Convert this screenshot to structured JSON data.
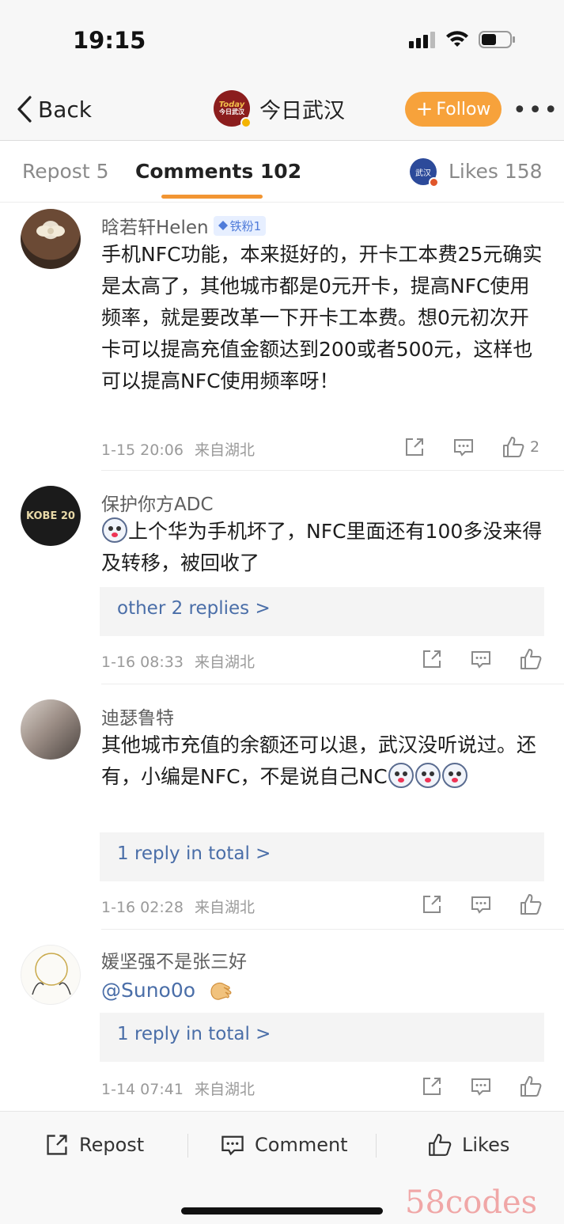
{
  "status": {
    "time": "19:15"
  },
  "nav": {
    "back_label": "Back",
    "account_name": "今日武汉",
    "logo_text_top": "Today",
    "logo_text_bottom": "今日武汉",
    "follow_label": "Follow",
    "more_label": "•••"
  },
  "tabs": {
    "repost": "Repost 5",
    "comments": "Comments 102",
    "likes": "Likes 158",
    "likes_avatar_text": "武汉"
  },
  "comments": [
    {
      "name": "晗若轩Helen",
      "badge": "铁粉1",
      "text": "手机NFC功能，本来挺好的，开卡工本费25元确实是太高了，其他城市都是0元开卡，提高NFC使用频率，就是要改革一下开卡工本费。想0元初次开卡可以提高充值金额达到200或者500元，这样也可以提高NFC使用频率呀！",
      "time": "1-15 20:06",
      "location": "来自湖北",
      "like_count": "2"
    },
    {
      "name": "保护你方ADC",
      "text": "上个华为手机坏了，NFC里面还有100多没来得及转移，被回收了",
      "replies": "other 2 replies >",
      "time": "1-16 08:33",
      "location": "来自湖北",
      "avatar_text": "KOBE 20"
    },
    {
      "name": "迪瑟鲁特",
      "text": "其他城市充值的余额还可以退，武汉没听说过。还有，小编是NFC，不是说自己NC",
      "replies": "1 reply in total >",
      "time": "1-16 02:28",
      "location": "来自湖北"
    },
    {
      "name": "媛坚强不是张三好",
      "mention": "@Suno0o",
      "replies": "1 reply in total >",
      "time": "1-14 07:41",
      "location": "来自湖北"
    }
  ],
  "bottom": {
    "repost": "Repost",
    "comment": "Comment",
    "likes": "Likes"
  },
  "watermark": "58codes",
  "colors": {
    "accent_orange": "#f7a23b",
    "link_blue": "#4a6ea8",
    "tab_underline": "#f29532"
  }
}
